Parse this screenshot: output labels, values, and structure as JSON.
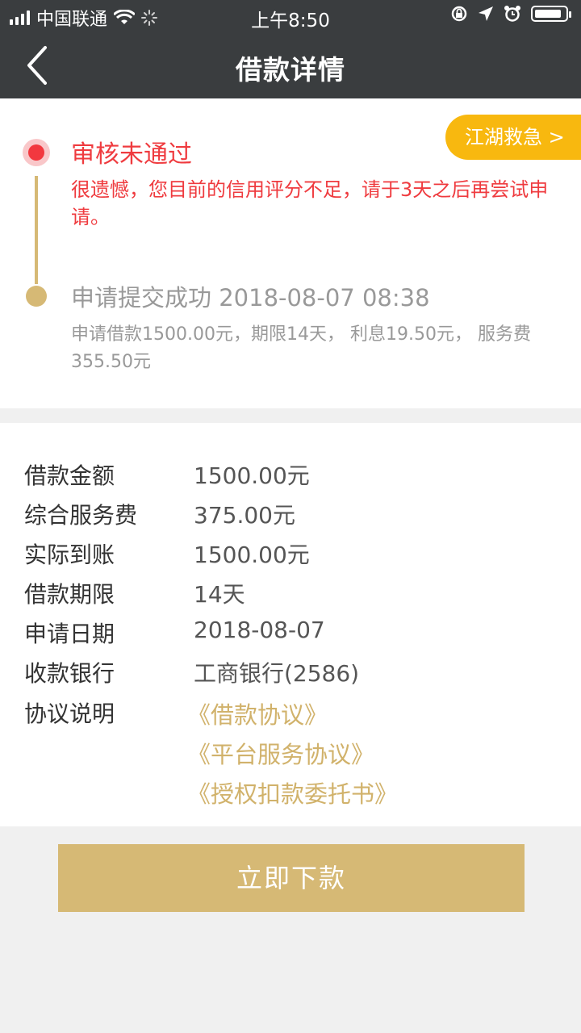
{
  "status_bar": {
    "carrier": "中国联通",
    "time": "上午8:50",
    "icons": [
      "signal-icon",
      "wifi-icon",
      "loading-icon",
      "rotation-lock-icon",
      "location-icon",
      "alarm-icon",
      "battery-icon"
    ]
  },
  "nav": {
    "title": "借款详情",
    "back_icon": "chevron-left-icon"
  },
  "rescue_button": "江湖救急 >",
  "timeline": {
    "step1": {
      "title": "审核未通过",
      "desc": "很遗憾，您目前的信用评分不足，请于3天之后再尝试申请。"
    },
    "step2": {
      "title": "申请提交成功 2018-08-07 08:38",
      "desc": "申请借款1500.00元，期限14天， 利息19.50元， 服务费355.50元"
    }
  },
  "details": {
    "rows": [
      {
        "label": "借款金额",
        "value": "1500.00元"
      },
      {
        "label": "综合服务费",
        "value": "375.00元"
      },
      {
        "label": "实际到账",
        "value": "1500.00元"
      },
      {
        "label": "借款期限",
        "value": "14天"
      },
      {
        "label": "申请日期",
        "value": "2018-08-07"
      },
      {
        "label": "收款银行",
        "value": "工商银行(2586)"
      }
    ],
    "agreement_label": "协议说明",
    "agreements": [
      "《借款协议》",
      "《平台服务协议》",
      "《授权扣款委托书》"
    ]
  },
  "action_button": "立即下款",
  "colors": {
    "header_bg": "#3a3d3f",
    "accent_gold": "#d6b975",
    "rescue_orange": "#f8b80f",
    "error_red": "#ef3b3f",
    "page_bg": "#f0f0f0"
  }
}
